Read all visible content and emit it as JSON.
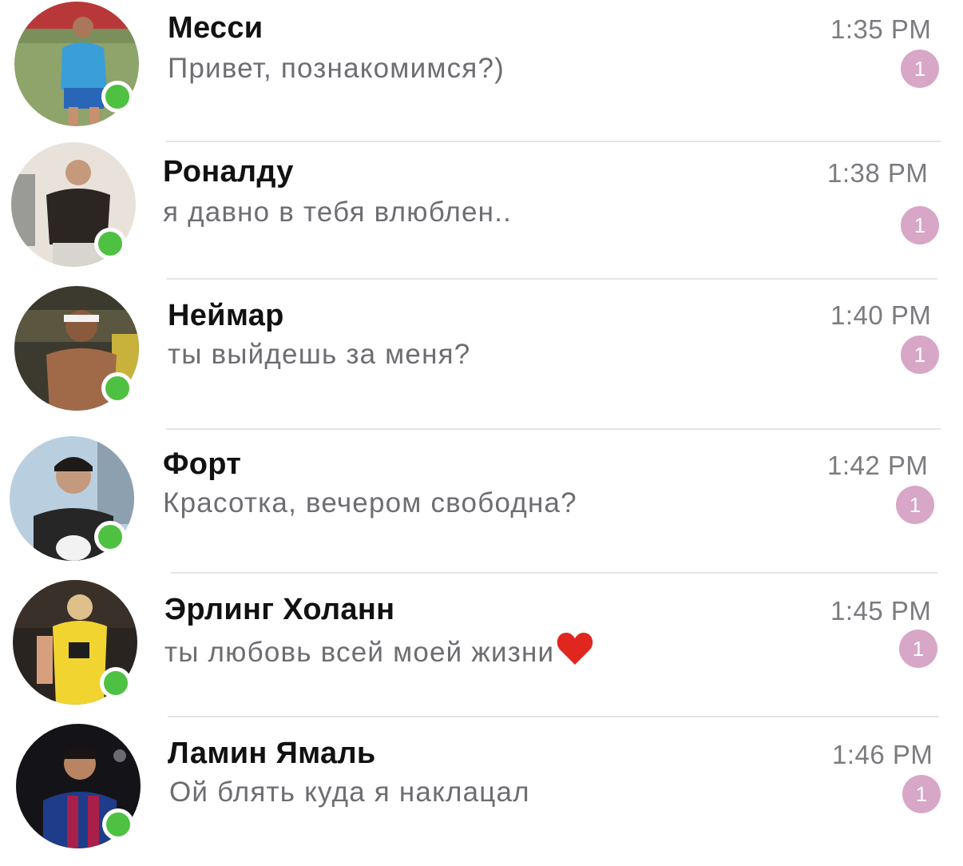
{
  "colors": {
    "online": "#4fc142",
    "badge": "#d8a6c6",
    "divider": "#e4e4e8",
    "preview_text": "#6d6d72",
    "time_text": "#7b7b80"
  },
  "chats": [
    {
      "name": "Месси",
      "preview": "Привет, познакомимся?)",
      "time": "1:35 PM",
      "unread": "1",
      "online": true,
      "avatar_icon": "football-player-blue-kit-photo"
    },
    {
      "name": "Роналду",
      "preview": "я давно в тебя влюблен..",
      "time": "1:38 PM",
      "unread": "1",
      "online": true,
      "avatar_icon": "man-dark-shirt-photo"
    },
    {
      "name": "Неймар",
      "preview": "ты выйдешь за меня?",
      "time": "1:40 PM",
      "unread": "1",
      "online": true,
      "avatar_icon": "player-headband-photo"
    },
    {
      "name": "Форт",
      "preview": "Красотка, вечером свободна?",
      "time": "1:42 PM",
      "unread": "1",
      "online": true,
      "avatar_icon": "young-player-black-shirt-photo"
    },
    {
      "name": "Эрлинг Холанн",
      "preview": "ты любовь всей моей жизни",
      "preview_emoji": "heart-icon",
      "time": "1:45 PM",
      "unread": "1",
      "online": true,
      "avatar_icon": "player-yellow-kit-photo"
    },
    {
      "name": "Ламин Ямаль",
      "preview": "Ой блять куда я наклацал",
      "time": "1:46 PM",
      "unread": "1",
      "online": true,
      "avatar_icon": "player-barcelona-kit-photo"
    }
  ]
}
